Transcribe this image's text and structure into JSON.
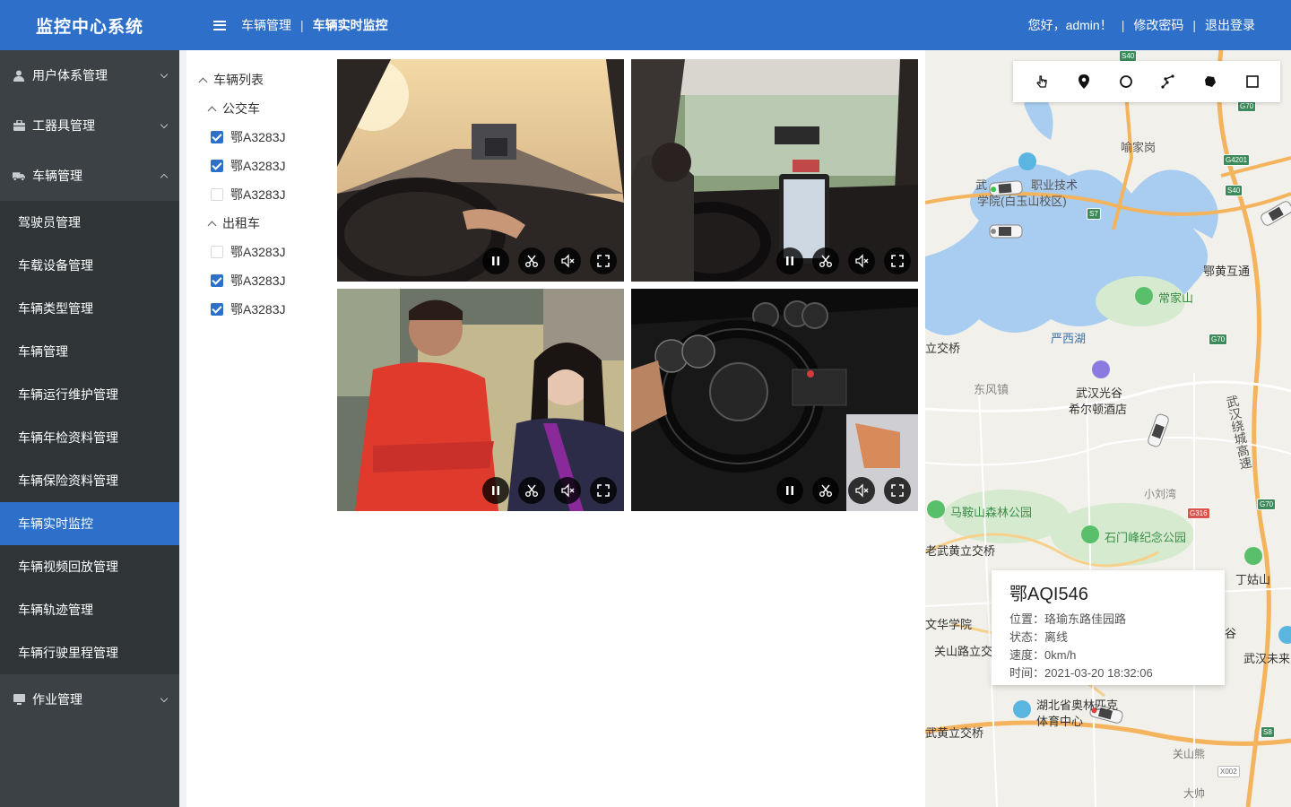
{
  "header": {
    "brand": "监控中心系统",
    "breadcrumb": [
      "车辆管理",
      "车辆实时监控"
    ],
    "greeting": "您好，admin！",
    "change_password": "修改密码",
    "logout": "退出登录",
    "breadcrumb_sep": "|"
  },
  "sidebar": {
    "groups": [
      {
        "label": "用户体系管理",
        "icon": "user-icon",
        "expanded": false
      },
      {
        "label": "工器具管理",
        "icon": "toolbox-icon",
        "expanded": false
      },
      {
        "label": "车辆管理",
        "icon": "truck-icon",
        "expanded": true
      },
      {
        "label": "作业管理",
        "icon": "monitor-icon",
        "expanded": false
      }
    ],
    "vehicle_items": [
      "驾驶员管理",
      "车载设备管理",
      "车辆类型管理",
      "车辆管理",
      "车辆运行维护管理",
      "车辆年检资料管理",
      "车辆保险资料管理",
      "车辆实时监控",
      "车辆视频回放管理",
      "车辆轨迹管理",
      "车辆行驶里程管理"
    ],
    "active_item": "车辆实时监控"
  },
  "tree": {
    "root": "车辆列表",
    "groups": [
      {
        "label": "公交车",
        "items": [
          {
            "label": "鄂A3283J",
            "checked": true
          },
          {
            "label": "鄂A3283J",
            "checked": true
          },
          {
            "label": "鄂A3283J",
            "checked": false
          }
        ]
      },
      {
        "label": "出租车",
        "items": [
          {
            "label": "鄂A3283J",
            "checked": false
          },
          {
            "label": "鄂A3283J",
            "checked": true
          },
          {
            "label": "鄂A3283J",
            "checked": true
          }
        ]
      }
    ]
  },
  "videos": {
    "controls": [
      "pause-icon",
      "scissors-icon",
      "mute-icon",
      "fullscreen-icon"
    ]
  },
  "map": {
    "tools": [
      "pointer-icon",
      "marker-icon",
      "circle-icon",
      "polyline-icon",
      "polygon-icon",
      "rectangle-icon"
    ],
    "info": {
      "plate": "鄂AQI546",
      "location_label": "位置：",
      "location": "珞瑜东路佳园路",
      "status_label": "状态：",
      "status": "离线",
      "speed_label": "速度：",
      "speed": "0km/h",
      "time_label": "时间：",
      "time": "2021-03-20 18:32:06"
    },
    "labels": {
      "l1": "喻家岗",
      "l2": "职业技术",
      "l3": "学院(白玉山校区)",
      "l4": "武",
      "l5": "鄂黄互通",
      "l6": "常家山",
      "l7": "严西湖",
      "l8": "立交桥",
      "l9": "东风镇",
      "l10": "武汉光谷",
      "l11": "希尔顿酒店",
      "l12": "武汉绕城高速",
      "l13": "小刘湾",
      "l14": "马鞍山森林公园",
      "l15": "石门峰纪念公园",
      "l16": "老武黄立交桥",
      "l17": "丁姑山",
      "l18": "文华学院",
      "l19": "关山路立交",
      "l20": "武汉未来",
      "l21": "湖北省奥林匹克",
      "l22": "体育中心",
      "l23": "武黄立交桥",
      "l24": "关山熊",
      "l25": "大帅",
      "l26": "谷"
    },
    "highways": [
      "S40",
      "G70",
      "G4201",
      "S40",
      "S7",
      "G70",
      "G316",
      "G70",
      "S8",
      "G316",
      "X002"
    ]
  }
}
